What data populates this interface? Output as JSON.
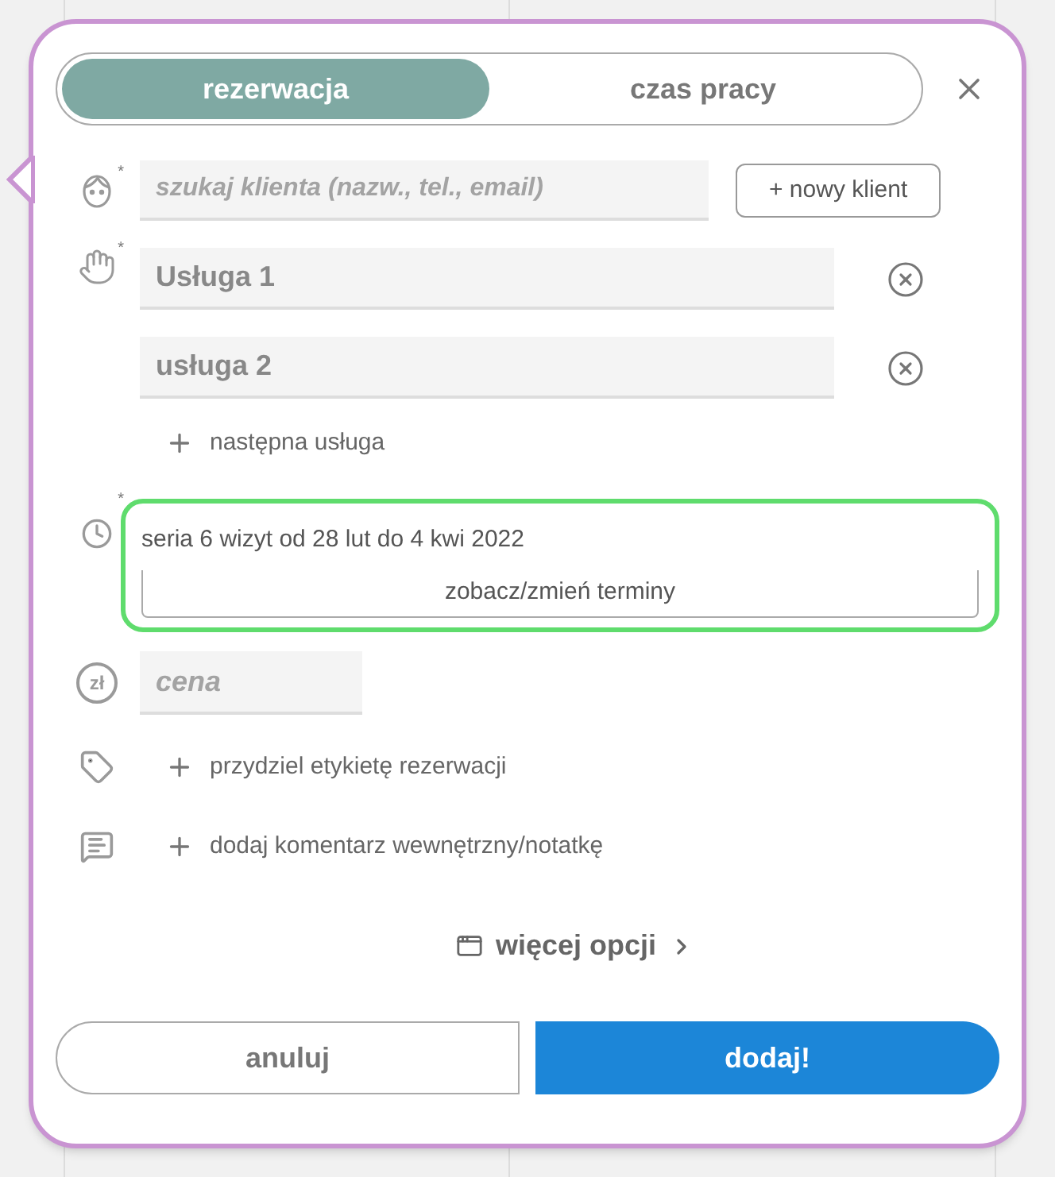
{
  "tabs": [
    {
      "label": "rezerwacja",
      "selected": true
    },
    {
      "label": "czas pracy",
      "selected": false
    }
  ],
  "client": {
    "required_mark": "*",
    "placeholder": "szukaj klienta (nazw., tel., email)",
    "new_button": "+ nowy klient"
  },
  "services": {
    "required_mark": "*",
    "items": [
      {
        "value": "Usługa 1"
      },
      {
        "value": "usługa 2"
      }
    ],
    "add_label": "następna usługa"
  },
  "series": {
    "required_mark": "*",
    "summary": "seria 6 wizyt od 28 lut do 4 kwi 2022",
    "button": "zobacz/zmień terminy"
  },
  "price": {
    "symbol": "zł",
    "placeholder": "cena"
  },
  "tag_action": "przydziel etykietę rezerwacji",
  "comment_action": "dodaj komentarz wewnętrzny/notatkę",
  "more_options": "więcej opcji",
  "buttons": {
    "cancel": "anuluj",
    "submit": "dodaj!"
  }
}
